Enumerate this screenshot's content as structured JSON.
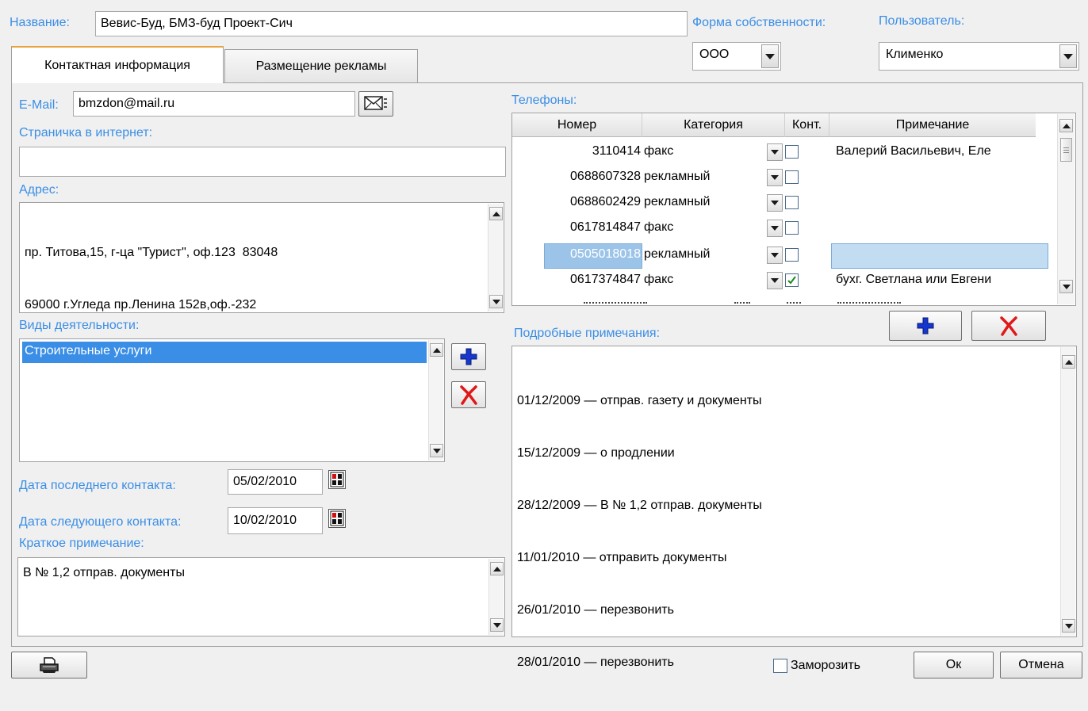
{
  "header": {
    "name_label": "Название:",
    "name_value": "Вевис-Буд,  БМЗ-буд Проект-Сич",
    "ownership_label": "Форма собственности:",
    "ownership_value": "ООО",
    "user_label": "Пользователь:",
    "user_value": "Клименко"
  },
  "tabs": [
    {
      "label": "Контактная информация",
      "active": true
    },
    {
      "label": "Размещение рекламы",
      "active": false
    }
  ],
  "contact": {
    "email_label": "E-Mail:",
    "email_value": "bmzdon@mail.ru",
    "web_label": "Страничка в интернет:",
    "web_value": "",
    "address_label": "Адрес:",
    "address_lines": [
      "пр. Титова,15, г-ца \"Турист\", оф.123  83048",
      "69000 г.Угледа пр.Ленина 152в,оф.-232"
    ],
    "activities_label": "Виды деятельности:",
    "activities": [
      "Строительные услуги"
    ],
    "last_contact_label": "Дата последнего контакта:",
    "last_contact_value": "05/02/2010",
    "next_contact_label": "Дата следующего контакта:",
    "next_contact_value": "10/02/2010",
    "short_note_label": "Краткое примечание:",
    "short_note_value": "В № 1,2 отправ. документы"
  },
  "phones": {
    "label": "Телефоны:",
    "columns": [
      "Номер",
      "Категория",
      "Конт.",
      "Примечание"
    ],
    "rows": [
      {
        "number": "3110414",
        "category": "факс",
        "checked": false,
        "note": "Валерий Васильевич, Еле",
        "selected": false
      },
      {
        "number": "0688607328",
        "category": "рекламный",
        "checked": false,
        "note": "",
        "selected": false
      },
      {
        "number": "0688602429",
        "category": "рекламный",
        "checked": false,
        "note": "",
        "selected": false
      },
      {
        "number": "0617814847",
        "category": "факс",
        "checked": false,
        "note": "",
        "selected": false
      },
      {
        "number": "0505018018",
        "category": "рекламный",
        "checked": false,
        "note": "",
        "selected": true
      },
      {
        "number": "0617374847",
        "category": "факс",
        "checked": true,
        "note": "бухг. Светлана или Евгени",
        "selected": false
      }
    ]
  },
  "notes": {
    "label": "Подробные примечания:",
    "lines": [
      "01/12/2009 — отправ. газету и документы",
      "15/12/2009 — о продлении",
      "28/12/2009 — В № 1,2 отправ. документы",
      "11/01/2010 — отправить документы",
      "26/01/2010 — перезвонить",
      "28/01/2010 — перезвонить"
    ]
  },
  "footer": {
    "freeze_label": "Заморозить",
    "ok_label": "Ок",
    "cancel_label": "Отмена"
  },
  "icons": {
    "print": "printer-icon",
    "mail": "mail-icon",
    "calendar": "calendar-icon",
    "add": "plus-icon",
    "delete": "delete-x-icon"
  },
  "colors": {
    "label_blue": "#3a8ee6",
    "selection": "#3a8ee6",
    "row_selected": "#c2dcf2"
  }
}
